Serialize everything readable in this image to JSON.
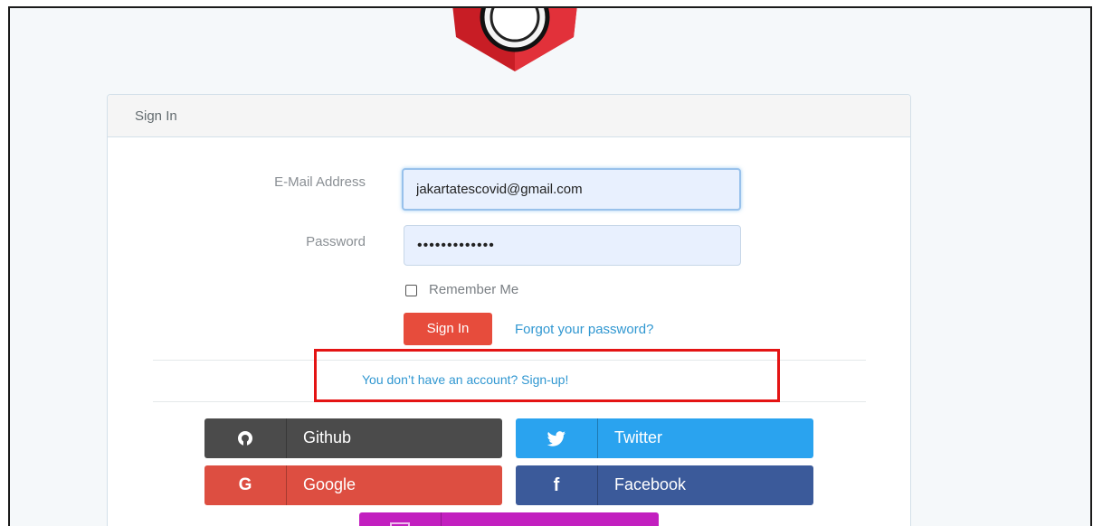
{
  "logo": {
    "icon": "laravel-shield-logo"
  },
  "panel": {
    "title": "Sign In"
  },
  "form": {
    "email_label": "E-Mail Address",
    "email_value": "jakartatescovid@gmail.com",
    "password_label": "Password",
    "password_value": "•••••••••••••",
    "remember_label": "Remember Me",
    "remember_checked": false,
    "signin_button": "Sign In",
    "forgot_link": "Forgot your password?",
    "signup_link": "You don’t have an account? Sign-up!"
  },
  "social": {
    "github": {
      "label": "Github",
      "icon": "github-icon",
      "color": "#4b4b4b"
    },
    "twitter": {
      "label": "Twitter",
      "icon": "twitter-icon",
      "color": "#2aa3ef"
    },
    "google": {
      "label": "Google",
      "icon": "google-icon",
      "color": "#dd4e41"
    },
    "facebook": {
      "label": "Facebook",
      "icon": "facebook-icon",
      "color": "#3b5a9a"
    },
    "extra": {
      "label": "",
      "icon": "unknown-icon",
      "color": "#c21fbf"
    }
  },
  "annotation": {
    "arrow_color": "#e41414",
    "highlight_color": "#e41414"
  }
}
